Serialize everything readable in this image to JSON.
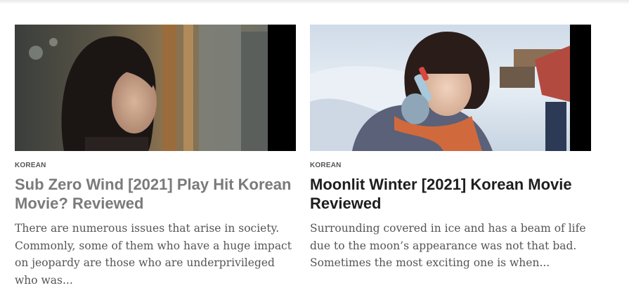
{
  "posts": [
    {
      "category": "KOREAN",
      "title": "Sub Zero Wind [2021] Play Hit Korean Movie? Reviewed",
      "excerpt": "There are numerous issues that arise in society. Commonly, some of them who have a huge impact on jeopardy are those who are underprivileged who was...",
      "title_color": "#7a7a7a"
    },
    {
      "category": "KOREAN",
      "title": "Moonlit Winter [2021] Korean Movie Reviewed",
      "excerpt": "Surrounding covered in ice and has a beam of life due to the moon’s appearance was not that bad. Sometimes the most exciting one is when...",
      "title_color": "#1e1e1e"
    }
  ]
}
